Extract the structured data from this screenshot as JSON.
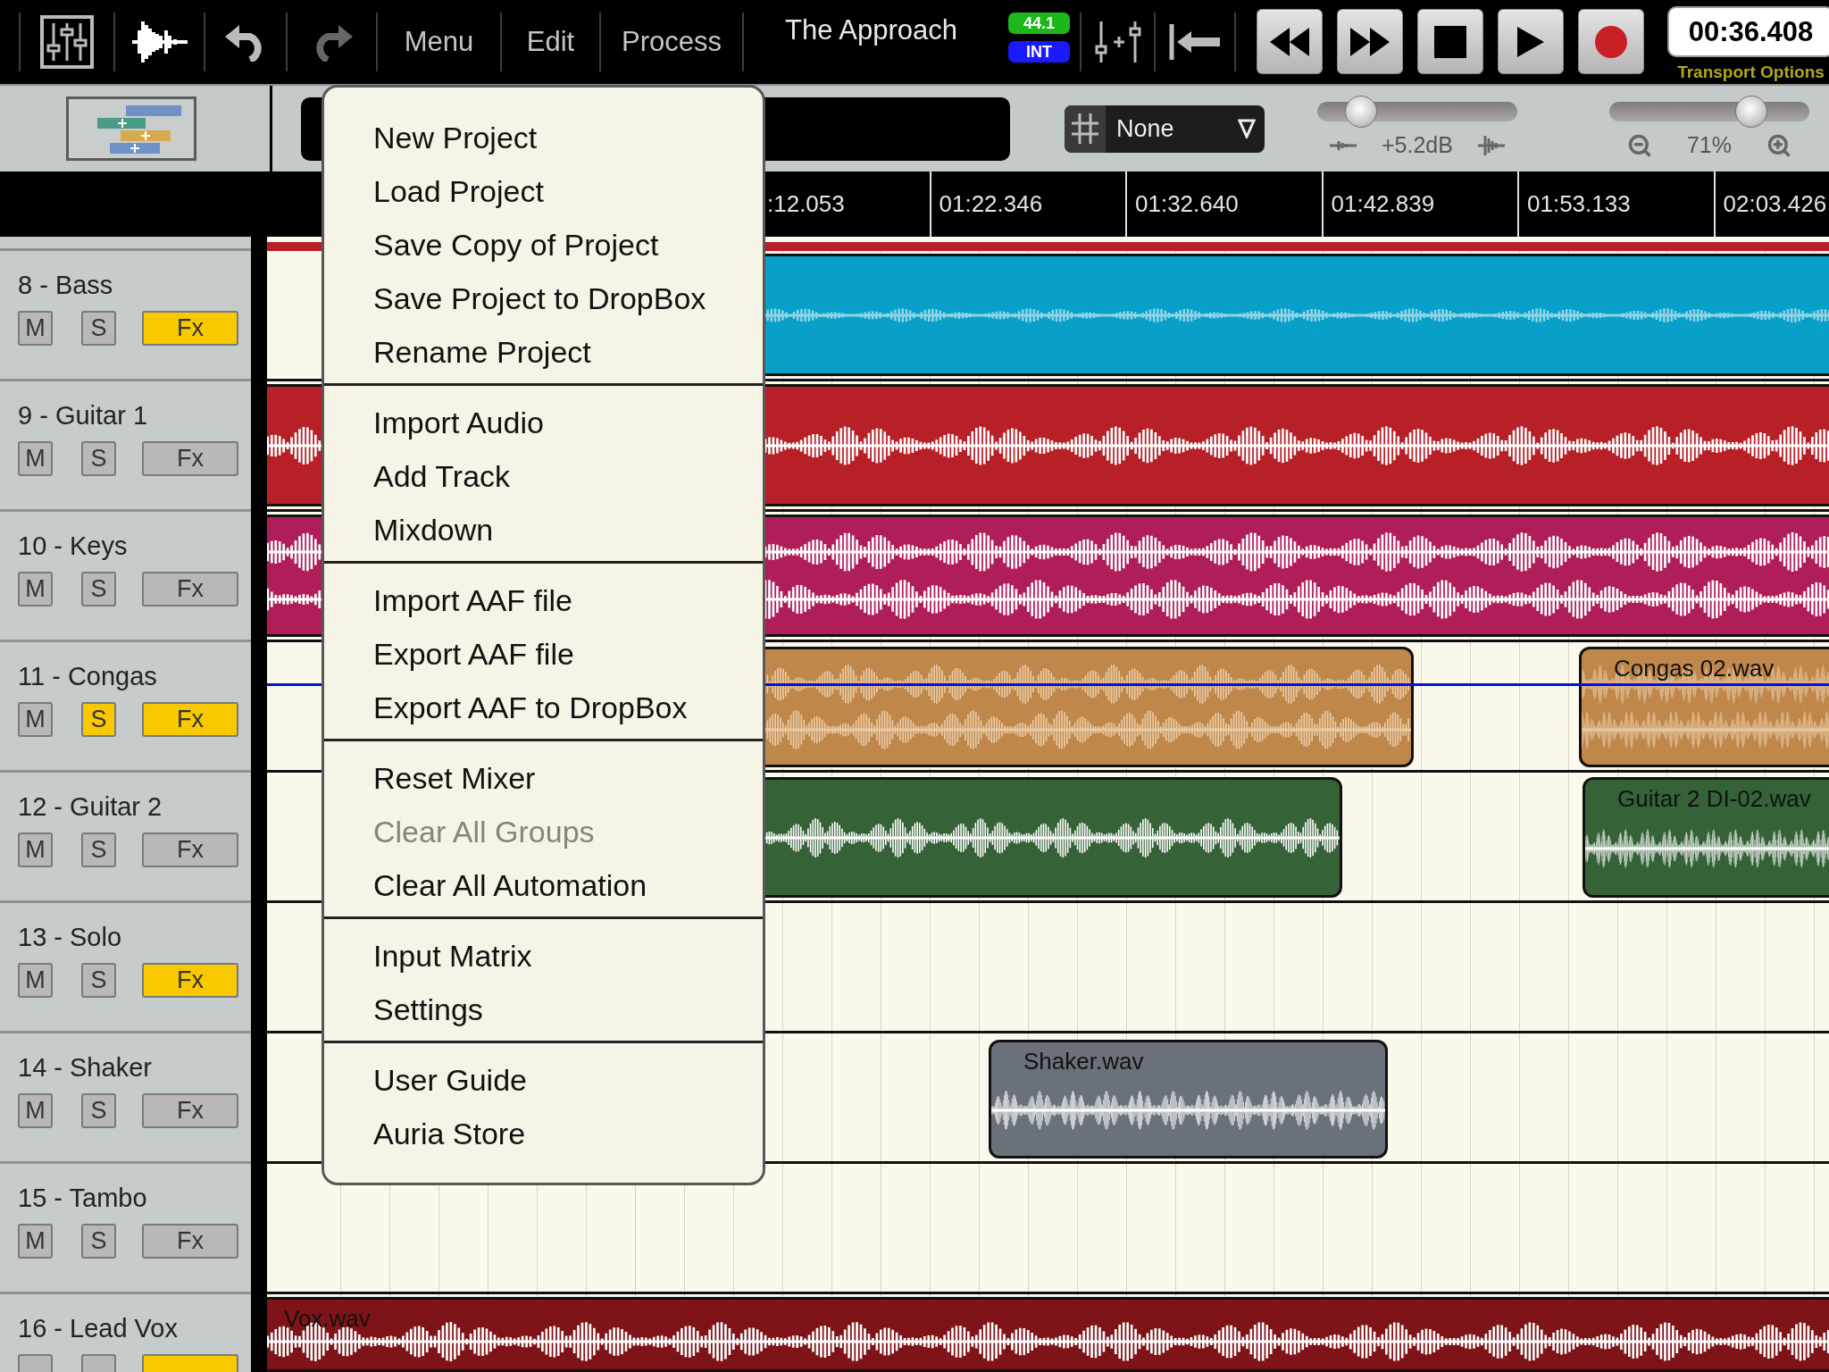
{
  "toolbar": {
    "undo_enabled": true,
    "redo_enabled": false,
    "menus": [
      {
        "label": "Menu"
      },
      {
        "label": "Edit"
      },
      {
        "label": "Process"
      }
    ],
    "project_title": "The Approach",
    "sample_rate": "44.1",
    "clock_source": "INT",
    "time": "00:36.408",
    "transport_options": "Transport Options"
  },
  "edit_bar": {
    "snap": "None",
    "volume": {
      "level": 0.22,
      "reading": "+5.2dB"
    },
    "zoom": {
      "level": 0.71,
      "reading": "71%"
    }
  },
  "ruler": [
    {
      "label": ":12.053",
      "kind": "partial"
    },
    {
      "label": "01:22.346",
      "kind": "full"
    },
    {
      "label": "01:32.640",
      "kind": "full"
    },
    {
      "label": "01:42.839",
      "kind": "full"
    },
    {
      "label": "01:53.133",
      "kind": "full"
    },
    {
      "label": "02:03.426",
      "kind": "full"
    }
  ],
  "tracks": [
    {
      "name": "8 - Bass",
      "controls": [
        {
          "label": "M",
          "on": false
        },
        {
          "label": "S",
          "on": false
        },
        {
          "label": "Fx",
          "on": true
        }
      ],
      "color": "#08a0c8"
    },
    {
      "name": "9 - Guitar 1",
      "controls": [
        {
          "label": "M",
          "on": false
        },
        {
          "label": "S",
          "on": false
        },
        {
          "label": "Fx",
          "on": false
        }
      ],
      "color": "#b82028"
    },
    {
      "name": "10 - Keys",
      "controls": [
        {
          "label": "M",
          "on": false
        },
        {
          "label": "S",
          "on": false
        },
        {
          "label": "Fx",
          "on": false
        }
      ],
      "color": "#b01e5a"
    },
    {
      "name": "11 - Congas",
      "controls": [
        {
          "label": "M",
          "on": false
        },
        {
          "label": "S",
          "on": true
        },
        {
          "label": "Fx",
          "on": true
        }
      ],
      "color": "#bf874a",
      "automation": true,
      "clips": [
        {
          "name": "Congas 02.wav"
        }
      ]
    },
    {
      "name": "12 - Guitar 2",
      "controls": [
        {
          "label": "M",
          "on": false
        },
        {
          "label": "S",
          "on": false
        },
        {
          "label": "Fx",
          "on": false
        }
      ],
      "color": "#366238",
      "clips": [
        {
          "name": "Guitar 2 DI-02.wav"
        }
      ]
    },
    {
      "name": "13 - Solo",
      "controls": [
        {
          "label": "M",
          "on": false
        },
        {
          "label": "S",
          "on": false
        },
        {
          "label": "Fx",
          "on": true
        }
      ]
    },
    {
      "name": "14 - Shaker",
      "controls": [
        {
          "label": "M",
          "on": false
        },
        {
          "label": "S",
          "on": false
        },
        {
          "label": "Fx",
          "on": false
        }
      ],
      "color": "#6a7179",
      "clips": [
        {
          "name": "Shaker.wav"
        }
      ]
    },
    {
      "name": "15 - Tambo",
      "controls": [
        {
          "label": "M",
          "on": false
        },
        {
          "label": "S",
          "on": false
        },
        {
          "label": "Fx",
          "on": false
        }
      ]
    },
    {
      "name": "16 - Lead Vox",
      "controls": [
        {
          "on": false
        },
        {
          "on": false
        },
        {
          "on": true
        }
      ],
      "color": "#7f1418",
      "clips": [
        {
          "name": "Vox.wav"
        }
      ]
    }
  ],
  "menu": {
    "sections": [
      {
        "items": [
          {
            "label": "New Project",
            "disabled": false
          },
          {
            "label": "Load Project",
            "disabled": false
          },
          {
            "label": "Save Copy of Project",
            "disabled": false
          },
          {
            "label": "Save Project to DropBox",
            "disabled": false
          },
          {
            "label": "Rename Project",
            "disabled": false
          }
        ]
      },
      {
        "items": [
          {
            "label": "Import Audio",
            "disabled": false
          },
          {
            "label": "Add Track",
            "disabled": false
          },
          {
            "label": "Mixdown",
            "disabled": false
          }
        ]
      },
      {
        "items": [
          {
            "label": "Import AAF file",
            "disabled": false
          },
          {
            "label": "Export AAF file",
            "disabled": false
          },
          {
            "label": "Export AAF to DropBox",
            "disabled": false
          }
        ]
      },
      {
        "items": [
          {
            "label": "Reset Mixer",
            "disabled": false
          },
          {
            "label": "Clear All Groups",
            "disabled": true
          },
          {
            "label": "Clear All Automation",
            "disabled": false
          }
        ]
      },
      {
        "items": [
          {
            "label": "Input Matrix",
            "disabled": false
          },
          {
            "label": "Settings",
            "disabled": false
          }
        ]
      },
      {
        "items": [
          {
            "label": "User Guide",
            "disabled": false
          },
          {
            "label": "Auria Store",
            "disabled": false
          }
        ]
      }
    ]
  }
}
